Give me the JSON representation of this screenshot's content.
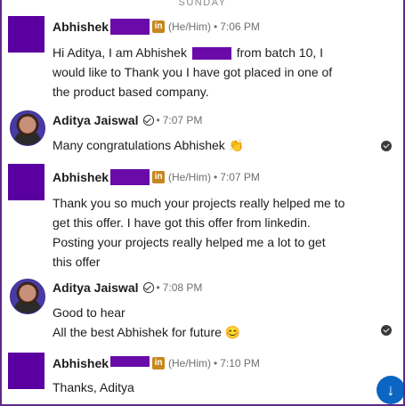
{
  "day_separator": "SUNDAY",
  "messages": [
    {
      "sender": "Abhishek",
      "badge": "in",
      "pronouns": "(He/Him)",
      "separator": "•",
      "time": "7:06 PM",
      "text": "Hi Aditya, I am Abhishek [redacted] from batch 10, I would like to Thank you I have got placed in one of the product based company.",
      "text_before": "Hi Aditya, I am Abhishek ",
      "text_after": " from batch 10, I\nwould like to Thank you I have got placed in one of\nthe product based company."
    },
    {
      "sender": "Aditya Jaiswal",
      "separator": "•",
      "time": "7:07 PM",
      "text": "Many congratulations Abhishek 👏"
    },
    {
      "sender": "Abhishek",
      "badge": "in",
      "pronouns": "(He/Him)",
      "separator": "•",
      "time": "7:07 PM",
      "text": "Thank you so much your projects really helped me to\nget this offer. I have got this offer from linkedin.\nPosting your projects really helped me a lot to get\nthis offer"
    },
    {
      "sender": "Aditya Jaiswal",
      "separator": "•",
      "time": "7:08 PM",
      "text": "Good to hear\nAll the best Abhishek for future 😊"
    },
    {
      "sender": "Abhishek",
      "badge": "in",
      "pronouns": "(He/Him)",
      "separator": "•",
      "time": "7:10 PM",
      "text": "Thanks, Aditya"
    }
  ],
  "scroll_button_icon": "arrow-down-icon",
  "scroll_button_glyph": "↓",
  "colors": {
    "redaction": "#6a0aa8",
    "frame_border": "#5c2a86",
    "premium_badge": "#c7871f",
    "scroll_button": "#0a66c2"
  }
}
